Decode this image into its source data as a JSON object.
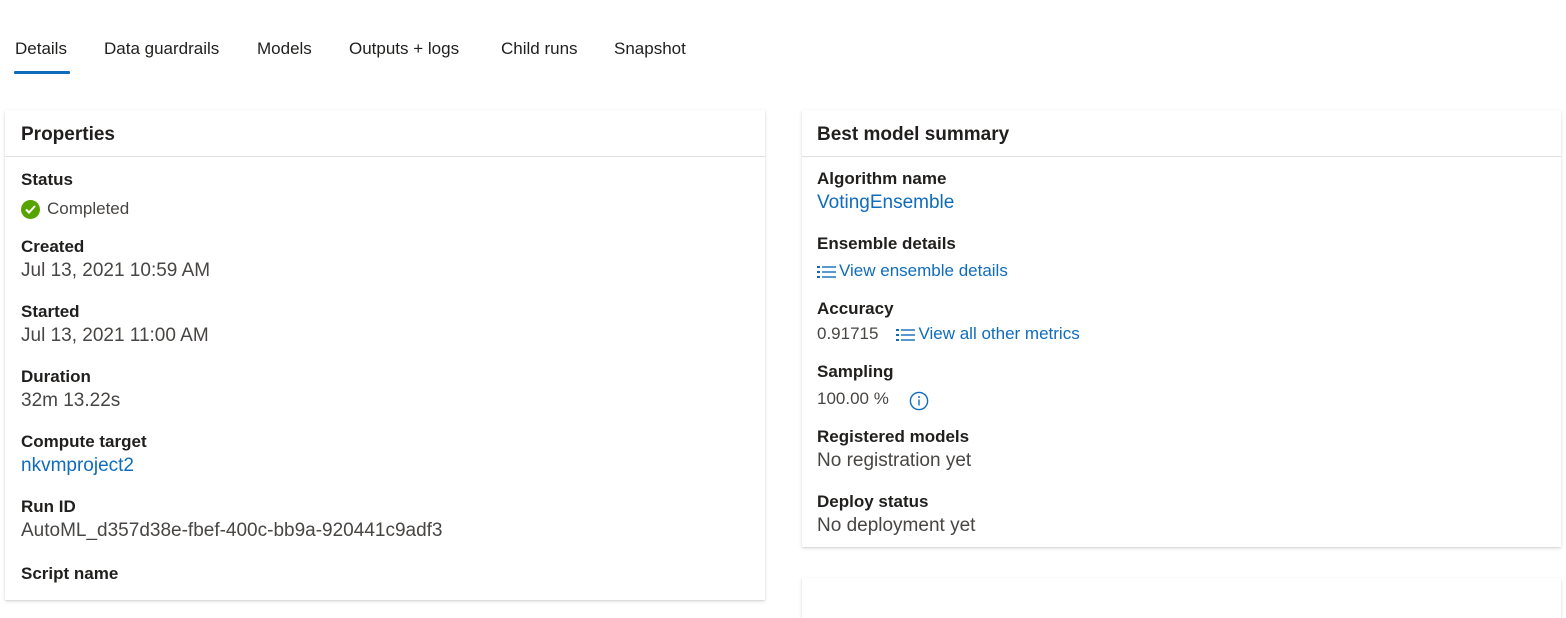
{
  "tabs": [
    {
      "label": "Details",
      "active": true
    },
    {
      "label": "Data guardrails",
      "active": false
    },
    {
      "label": "Models",
      "active": false
    },
    {
      "label": "Outputs + logs",
      "active": false
    },
    {
      "label": "Child runs",
      "active": false
    },
    {
      "label": "Snapshot",
      "active": false
    }
  ],
  "properties": {
    "title": "Properties",
    "status_label": "Status",
    "status_value": "Completed",
    "created_label": "Created",
    "created_value": "Jul 13, 2021 10:59 AM",
    "started_label": "Started",
    "started_value": "Jul 13, 2021 11:00 AM",
    "duration_label": "Duration",
    "duration_value": "32m 13.22s",
    "compute_label": "Compute target",
    "compute_value": "nkvmproject2",
    "runid_label": "Run ID",
    "runid_value": "AutoML_d357d38e-fbef-400c-bb9a-920441c9adf3",
    "script_label": "Script name"
  },
  "summary": {
    "title": "Best model summary",
    "algorithm_label": "Algorithm name",
    "algorithm_value": "VotingEnsemble",
    "ensemble_label": "Ensemble details",
    "ensemble_link": "View ensemble details",
    "accuracy_label": "Accuracy",
    "accuracy_value": "0.91715",
    "metrics_link": "View all other metrics",
    "sampling_label": "Sampling",
    "sampling_value": "100.00 %",
    "registered_label": "Registered models",
    "registered_value": "No registration yet",
    "deploy_label": "Deploy status",
    "deploy_value": "No deployment yet"
  },
  "colors": {
    "accent": "#0f6cbd",
    "success": "#57a300",
    "text": "#201f1e",
    "muted": "#484644"
  },
  "icons": {
    "status": "check-circle-icon",
    "list": "list-icon",
    "info": "info-icon"
  }
}
